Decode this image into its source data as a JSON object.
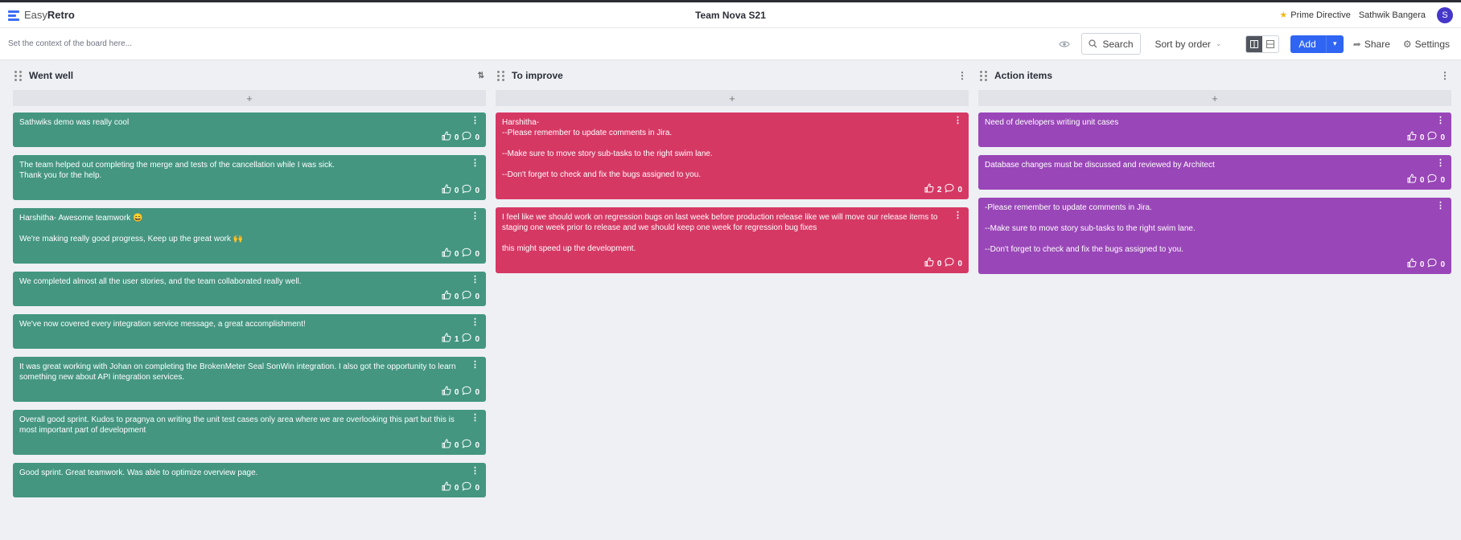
{
  "header": {
    "logo_easy": "Easy",
    "logo_retro": "Retro",
    "board_title": "Team Nova S21",
    "prime_directive": "Prime Directive",
    "user_name": "Sathwik Bangera",
    "avatar_initial": "S"
  },
  "toolbar": {
    "context_placeholder": "Set the context of the board here...",
    "search_label": "Search",
    "sort_label": "Sort by order",
    "add_label": "Add",
    "share_label": "Share",
    "settings_label": "Settings"
  },
  "columns": [
    {
      "title": "Went well",
      "cards": [
        {
          "text": "Sathwiks demo was really cool",
          "likes": "0",
          "comments": "0"
        },
        {
          "text": "The team helped out completing the merge and tests of the cancellation while I was sick.\nThank you for the help.",
          "likes": "0",
          "comments": "0"
        },
        {
          "text": "Harshitha- Awesome teamwork 😄\n\nWe're making really good progress, Keep up the great work 🙌",
          "likes": "0",
          "comments": "0"
        },
        {
          "text": "We completed almost all the user stories, and the team collaborated really well.",
          "likes": "0",
          "comments": "0"
        },
        {
          "text": "We've now covered every integration service message, a great accomplishment!",
          "likes": "1",
          "comments": "0"
        },
        {
          "text": "It was great working with Johan on completing the BrokenMeter Seal SonWin integration. I also got the opportunity to learn something new about API integration services.",
          "likes": "0",
          "comments": "0"
        },
        {
          "text": "Overall good sprint. Kudos to pragnya on writing the unit test cases only area where we are overlooking this part but this is most important part of development",
          "likes": "0",
          "comments": "0"
        },
        {
          "text": "Good sprint. Great teamwork. Was able to optimize overview page.",
          "likes": "0",
          "comments": "0"
        }
      ]
    },
    {
      "title": "To improve",
      "cards": [
        {
          "text": "Harshitha-\n--Please remember to update comments in Jira.\n\n--Make sure to move story sub-tasks to the right swim lane.\n\n--Don't forget to check and fix the bugs assigned to you.",
          "likes": "2",
          "comments": "0"
        },
        {
          "text": "I feel like we should work on regression bugs on last week before production release like we will move our release items to staging one week prior to release and we should keep one week for regression bug fixes\n\nthis might speed up the development.",
          "likes": "0",
          "comments": "0"
        }
      ]
    },
    {
      "title": "Action items",
      "cards": [
        {
          "text": "Need of developers writing unit cases",
          "likes": "0",
          "comments": "0"
        },
        {
          "text": "Database changes must be discussed and reviewed by Architect",
          "likes": "0",
          "comments": "0"
        },
        {
          "text": "-Please remember to update comments in Jira.\n\n--Make sure to move story sub-tasks to the right swim lane.\n\n--Don't forget to check and fix the bugs assigned to you.",
          "likes": "0",
          "comments": "0"
        }
      ]
    }
  ],
  "colors": {
    "went_well": "#449681",
    "to_improve": "#d63864",
    "action_items": "#9946b8",
    "accent": "#2f65f2"
  }
}
